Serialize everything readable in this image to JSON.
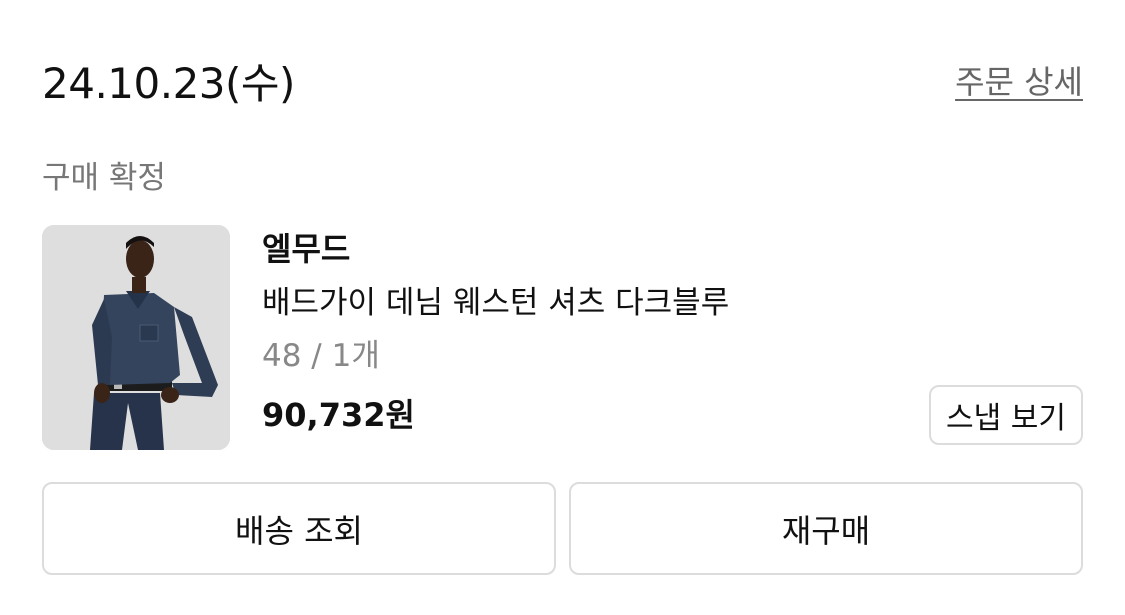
{
  "order": {
    "date": "24.10.23(수)",
    "detail_link": "주문 상세",
    "status": "구매 확정"
  },
  "product": {
    "brand": "엘무드",
    "name": "배드가이 데님 웨스턴 셔츠 다크블루",
    "option": "48 / 1개",
    "price": "90,732원",
    "snap_button": "스냅 보기",
    "image_description_icon": "product-photo"
  },
  "actions": {
    "tracking_button": "배송 조회",
    "reorder_button": "재구매"
  },
  "colors": {
    "text_primary": "#111111",
    "text_secondary": "#777777",
    "border": "#dcdcdc",
    "denim": "#2f3d52"
  }
}
